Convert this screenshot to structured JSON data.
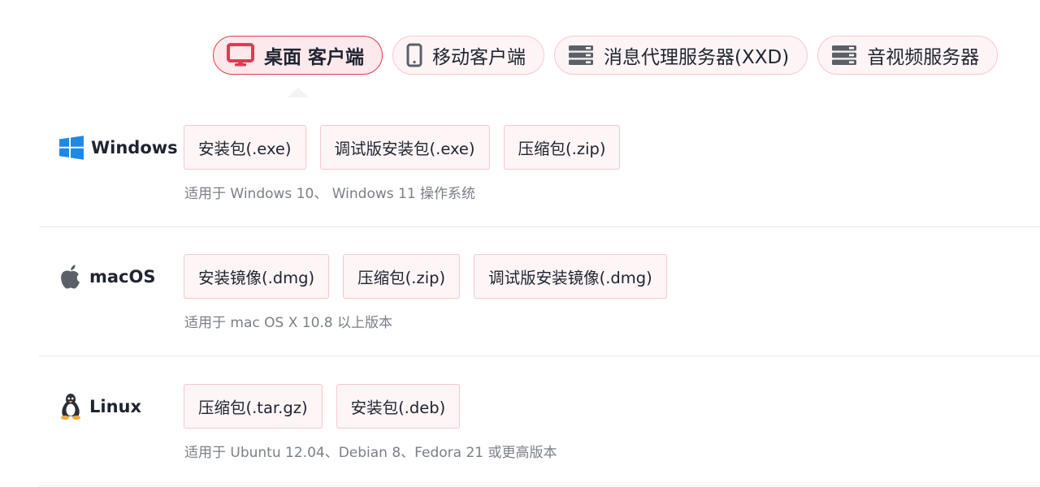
{
  "colors": {
    "accent": "#e03a52",
    "tab_border": "#f7c9d1",
    "tab_bg": "#fdf4f5",
    "button_border": "#f5c8cf",
    "button_bg": "#fdf5f6",
    "note_text": "#7a7f88",
    "divider": "#e6e8eb"
  },
  "tabs": [
    {
      "label": "桌面 客户端",
      "icon": "desktop-monitor-icon",
      "active": true
    },
    {
      "label": "移动客户端",
      "icon": "mobile-phone-icon",
      "active": false
    },
    {
      "label": "消息代理服务器(XXD)",
      "icon": "server-icon",
      "active": false
    },
    {
      "label": "音视频服务器",
      "icon": "server-icon",
      "active": false
    }
  ],
  "platforms": [
    {
      "name": "Windows",
      "icon": "windows-logo-icon",
      "buttons": [
        "安装包(.exe)",
        "调试版安装包(.exe)",
        "压缩包(.zip)"
      ],
      "note": "适用于 Windows 10、 Windows 11 操作系统"
    },
    {
      "name": "macOS",
      "icon": "apple-logo-icon",
      "buttons": [
        "安装镜像(.dmg)",
        "压缩包(.zip)",
        "调试版安装镜像(.dmg)"
      ],
      "note": "适用于 mac OS X 10.8 以上版本"
    },
    {
      "name": "Linux",
      "icon": "linux-tux-icon",
      "buttons": [
        "压缩包(.tar.gz)",
        "安装包(.deb)"
      ],
      "note": "适用于 Ubuntu 12.04、Debian 8、Fedora 21 或更高版本"
    }
  ]
}
